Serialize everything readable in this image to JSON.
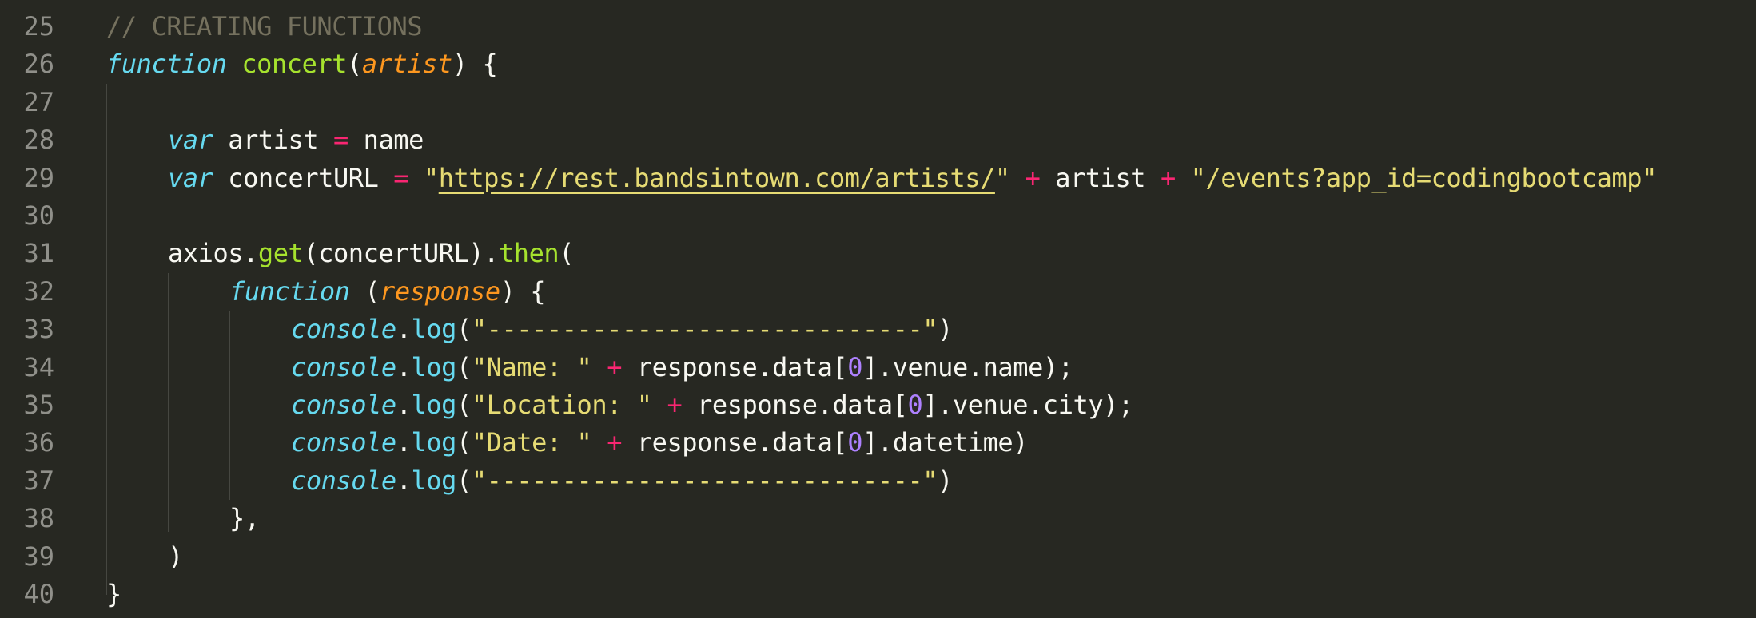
{
  "editor": {
    "theme_colors": {
      "background": "#272822",
      "gutter_text": "#90908a",
      "comment": "#75715e",
      "keyword_storage": "#66d9ef",
      "function_name": "#a6e22e",
      "parameter": "#fd971f",
      "operator": "#f92672",
      "string": "#e6db74",
      "number": "#ae81ff",
      "text": "#f8f8f2"
    },
    "lines": [
      {
        "number": "25",
        "tokens": {
          "t0": "// CREATING FUNCTIONS"
        }
      },
      {
        "number": "26",
        "tokens": {
          "t0": "function",
          "t1": " ",
          "t2": "concert",
          "t3": "(",
          "t4": "artist",
          "t5": ") {"
        }
      },
      {
        "number": "27",
        "tokens": {}
      },
      {
        "number": "28",
        "tokens": {
          "t0": "var",
          "t1": " artist ",
          "t2": "=",
          "t3": " name"
        }
      },
      {
        "number": "29",
        "tokens": {
          "t0": "var",
          "t1": " concertURL ",
          "t2": "=",
          "t3": " ",
          "t4": "\"",
          "t5": "https://rest.bandsintown.com/artists/",
          "t6": "\"",
          "t7": " ",
          "t8": "+",
          "t9": " artist ",
          "t10": "+",
          "t11": " ",
          "t12": "\"/events?app_id=codingbootcamp\""
        }
      },
      {
        "number": "30",
        "tokens": {}
      },
      {
        "number": "31",
        "tokens": {
          "t0": "axios.",
          "t1": "get",
          "t2": "(concertURL).",
          "t3": "then",
          "t4": "("
        }
      },
      {
        "number": "32",
        "tokens": {
          "t0": "function",
          "t1": " (",
          "t2": "response",
          "t3": ") {"
        }
      },
      {
        "number": "33",
        "tokens": {
          "t0": "console",
          "t1": ".",
          "t2": "log",
          "t3": "(",
          "t4": "\"-----------------------------\"",
          "t5": ")"
        }
      },
      {
        "number": "34",
        "tokens": {
          "t0": "console",
          "t1": ".",
          "t2": "log",
          "t3": "(",
          "t4": "\"Name: \"",
          "t5": " ",
          "t6": "+",
          "t7": " response.data[",
          "t8": "0",
          "t9": "].venue.name);"
        }
      },
      {
        "number": "35",
        "tokens": {
          "t0": "console",
          "t1": ".",
          "t2": "log",
          "t3": "(",
          "t4": "\"Location: \"",
          "t5": " ",
          "t6": "+",
          "t7": " response.data[",
          "t8": "0",
          "t9": "].venue.city);"
        }
      },
      {
        "number": "36",
        "tokens": {
          "t0": "console",
          "t1": ".",
          "t2": "log",
          "t3": "(",
          "t4": "\"Date: \"",
          "t5": " ",
          "t6": "+",
          "t7": " response.data[",
          "t8": "0",
          "t9": "].datetime)"
        }
      },
      {
        "number": "37",
        "tokens": {
          "t0": "console",
          "t1": ".",
          "t2": "log",
          "t3": "(",
          "t4": "\"-----------------------------\"",
          "t5": ")"
        }
      },
      {
        "number": "38",
        "tokens": {
          "t0": "},"
        }
      },
      {
        "number": "39",
        "tokens": {
          "t0": ")"
        }
      },
      {
        "number": "40",
        "tokens": {
          "t0": "}"
        }
      }
    ]
  }
}
